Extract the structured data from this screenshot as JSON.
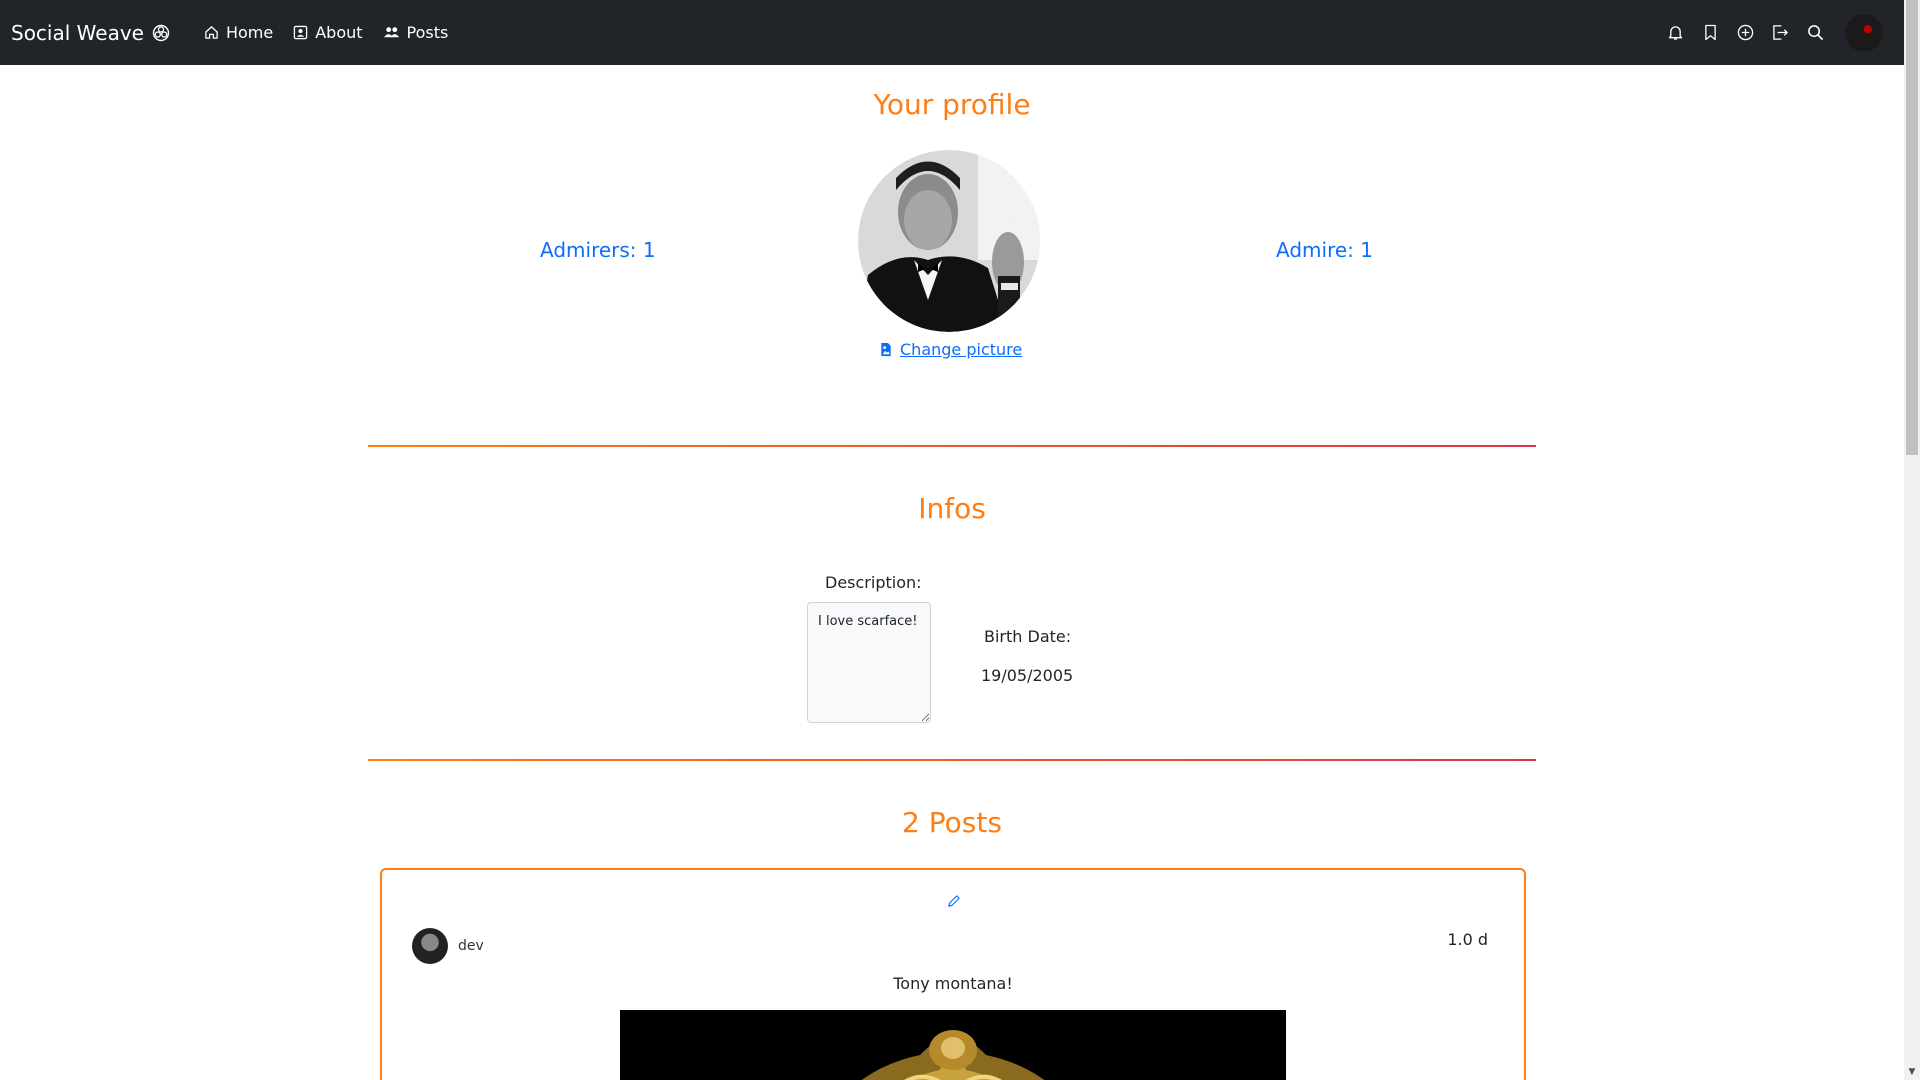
{
  "navbar": {
    "brand": "Social Weave",
    "links": [
      {
        "label": "Home",
        "icon": "home-icon"
      },
      {
        "label": "About",
        "icon": "about-icon"
      },
      {
        "label": "Posts",
        "icon": "users-icon"
      }
    ],
    "right_icons": [
      "bell-icon",
      "bookmark-icon",
      "plus-circle-icon",
      "logout-icon",
      "search-icon"
    ]
  },
  "profile": {
    "title": "Your profile",
    "admirers_label": "Admirers: 1",
    "admire_label": "Admire: 1",
    "change_picture": "Change picture"
  },
  "infos": {
    "title": "Infos",
    "description_label": "Description:",
    "description_value": "I love scarface!",
    "birth_label": "Birth Date:",
    "birth_value": "19/05/2005"
  },
  "posts": {
    "title": "2 Posts",
    "items": [
      {
        "author": "dev",
        "time": "1.0 d",
        "text": "Tony montana!"
      }
    ]
  },
  "colors": {
    "navbar_bg": "#212529",
    "accent": "#fd7e14",
    "link": "#0d6efd",
    "divider_end": "#dc3545"
  }
}
